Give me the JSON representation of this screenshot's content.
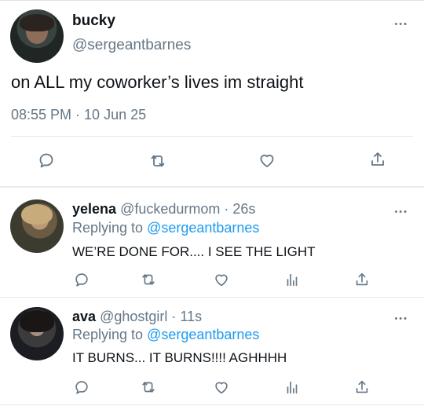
{
  "main_tweet": {
    "name": "bucky",
    "handle": "@sergeantbarnes",
    "text": "on ALL my coworker’s lives im straight",
    "timestamp": "08:55 PM · 10 Jun 25",
    "more": "•••"
  },
  "replies": [
    {
      "name": "yelena",
      "handle": "@fuckedurmom",
      "time": "· 26s",
      "replying_label": "Replying to",
      "replying_to": "@sergeantbarnes",
      "text": "WE’RE DONE FOR.... I SEE THE LIGHT",
      "more": "•••"
    },
    {
      "name": "ava",
      "handle": "@ghostgirl",
      "time": "· 11s",
      "replying_label": "Replying to",
      "replying_to": "@sergeantbarnes",
      "text": "IT BURNS... IT BURNS!!!! AGHHHH",
      "more": "•••"
    }
  ],
  "colors": {
    "accent": "#1d9bf0",
    "muted": "#657786",
    "divider": "#e1e8ed"
  }
}
